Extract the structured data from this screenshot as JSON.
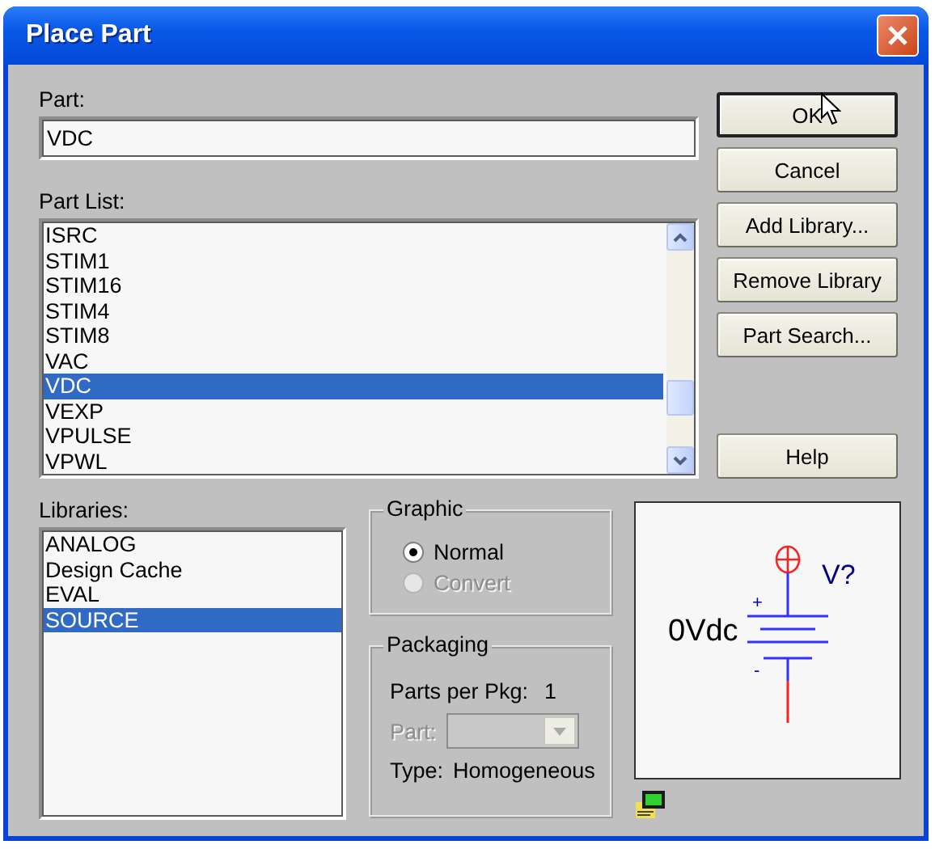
{
  "window": {
    "title": "Place Part"
  },
  "part": {
    "label": "Part:",
    "value": "VDC"
  },
  "part_list": {
    "label": "Part List:",
    "items": [
      {
        "text": "ISRC",
        "selected": false
      },
      {
        "text": "STIM1",
        "selected": false
      },
      {
        "text": "STIM16",
        "selected": false
      },
      {
        "text": "STIM4",
        "selected": false
      },
      {
        "text": "STIM8",
        "selected": false
      },
      {
        "text": "VAC",
        "selected": false
      },
      {
        "text": "VDC",
        "selected": true
      },
      {
        "text": "VEXP",
        "selected": false
      },
      {
        "text": "VPULSE",
        "selected": false
      },
      {
        "text": "VPWL",
        "selected": false
      }
    ]
  },
  "buttons": [
    {
      "label": "OK",
      "default": true
    },
    {
      "label": "Cancel",
      "default": false
    },
    {
      "label": "Add Library...",
      "default": false
    },
    {
      "label": "Remove Library",
      "default": false
    },
    {
      "label": "Part Search...",
      "default": false
    },
    {
      "label": "Help",
      "default": false
    }
  ],
  "libraries": {
    "label": "Libraries:",
    "items": [
      {
        "text": "ANALOG",
        "selected": false
      },
      {
        "text": "Design Cache",
        "selected": false
      },
      {
        "text": "EVAL",
        "selected": false
      },
      {
        "text": "SOURCE",
        "selected": true
      }
    ]
  },
  "graphic": {
    "title": "Graphic",
    "options": [
      {
        "label": "Normal",
        "selected": true,
        "disabled": false
      },
      {
        "label": "Convert",
        "selected": false,
        "disabled": true
      }
    ]
  },
  "packaging": {
    "title": "Packaging",
    "parts_per_pkg_label": "Parts per Pkg:",
    "parts_per_pkg": "1",
    "part_label": "Part:",
    "part_disabled": true,
    "type_label": "Type:",
    "type": "Homogeneous"
  },
  "preview": {
    "value": "0Vdc",
    "reference": "V?",
    "plus": "+",
    "minus": "-"
  }
}
